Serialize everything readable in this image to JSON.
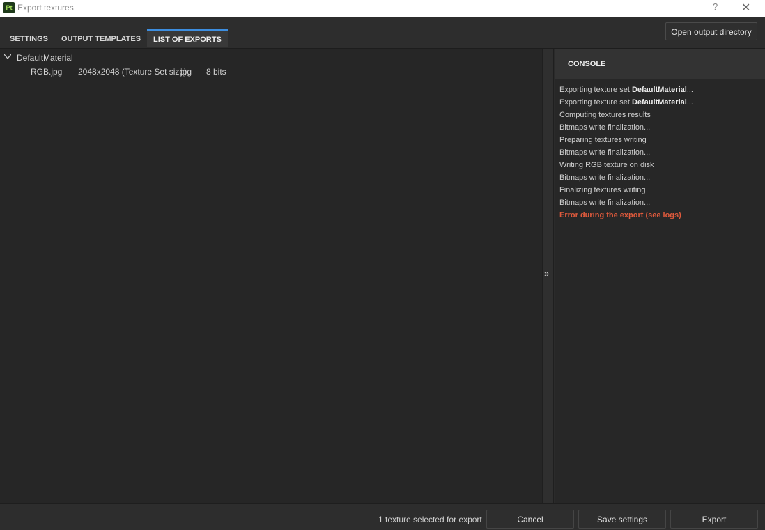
{
  "window": {
    "title": "Export textures",
    "app_icon_text": "Pt",
    "help_label": "?",
    "close_label": "✕"
  },
  "tabs": [
    {
      "label": "SETTINGS",
      "active": false
    },
    {
      "label": "OUTPUT TEMPLATES",
      "active": false
    },
    {
      "label": "LIST OF EXPORTS",
      "active": true
    }
  ],
  "toolbar": {
    "open_output_directory_label": "Open output directory"
  },
  "exports": {
    "material": "DefaultMaterial",
    "items": [
      {
        "name": "RGB.jpg",
        "size": "2048x2048 (Texture Set size)",
        "format": "jpg",
        "bits": "8 bits"
      }
    ]
  },
  "splitter": {
    "collapse_glyph": "»"
  },
  "console": {
    "title": "CONSOLE",
    "lines": [
      {
        "prefix": "Exporting texture set ",
        "bold": "DefaultMaterial",
        "suffix": "...",
        "type": "info"
      },
      {
        "prefix": "Exporting texture set ",
        "bold": "DefaultMaterial",
        "suffix": "...",
        "type": "info"
      },
      {
        "text": "Computing textures results",
        "type": "info"
      },
      {
        "text": "Bitmaps write finalization...",
        "type": "info"
      },
      {
        "text": "Preparing textures writing",
        "type": "info"
      },
      {
        "text": "Bitmaps write finalization...",
        "type": "info"
      },
      {
        "text": "Writing RGB texture on disk",
        "type": "info"
      },
      {
        "text": "Bitmaps write finalization...",
        "type": "info"
      },
      {
        "text": "Finalizing textures writing",
        "type": "info"
      },
      {
        "text": "Bitmaps write finalization...",
        "type": "info"
      },
      {
        "text": "Error during the export (see logs)",
        "type": "error"
      }
    ],
    "error_color": "#e05a3c"
  },
  "footer": {
    "status": "1 texture selected for export",
    "cancel_label": "Cancel",
    "save_settings_label": "Save settings",
    "export_label": "Export"
  },
  "colors": {
    "active_tab_accent": "#3d8ee0",
    "background": "#262626"
  }
}
